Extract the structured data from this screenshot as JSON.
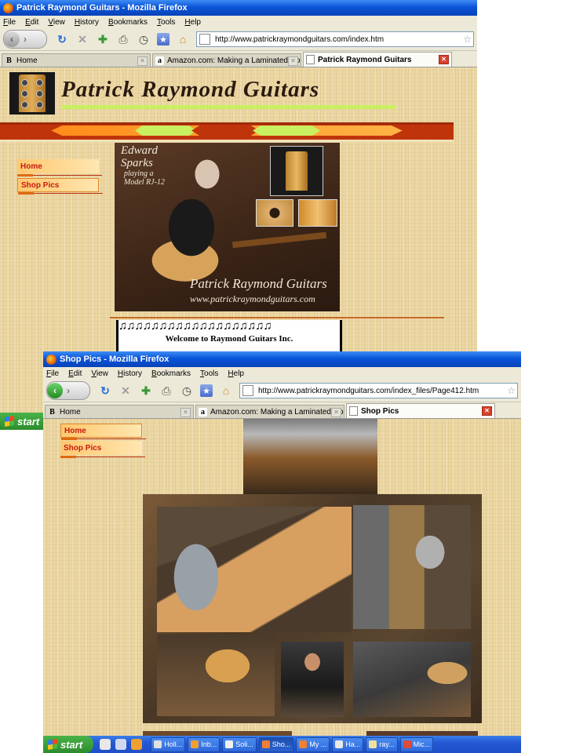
{
  "colors": {
    "title_bar": "#0a55d8",
    "page_background": "#ecd7a2",
    "nav_text": "#c81a0c",
    "accent_green": "#c8f060",
    "accent_orange": "#ff8c1a",
    "accent_red": "#c0340c"
  },
  "icons": [
    "firefox-icon",
    "back-icon",
    "forward-icon",
    "reload-icon",
    "stop-icon",
    "add-bookmark-icon",
    "print-icon",
    "history-icon",
    "bookmarks-icon",
    "home-icon",
    "page-icon",
    "star-icon",
    "tab-close-icon",
    "windows-flag-icon"
  ],
  "window_back": {
    "title": "Patrick Raymond Guitars - Mozilla Firefox",
    "menu": [
      "File",
      "Edit",
      "View",
      "History",
      "Bookmarks",
      "Tools",
      "Help"
    ],
    "url": "http://www.patrickraymondguitars.com/index.htm",
    "tabs": [
      {
        "label": "Home",
        "selected": false
      },
      {
        "label": "Amazon.com: Making a Laminated Hollo...",
        "selected": false
      },
      {
        "label": "Patrick Raymond Guitars",
        "selected": true
      }
    ],
    "page": {
      "site_title": "Patrick Raymond Guitars",
      "nav": [
        "Home",
        "Shop Pics"
      ],
      "photo_caption": [
        "Edward",
        "Sparks",
        "playing a",
        "Model RJ-12"
      ],
      "photo_brand": "Patrick Raymond Guitars",
      "photo_url": "www.patrickraymondguitars.com",
      "notes": "♫♫♫♫♫♫♫♫♫♫♫♫♫♫♫♫♫♫♫",
      "welcome": "Welcome to Raymond Guitars Inc."
    }
  },
  "taskbar_back": {
    "start": "start"
  },
  "window_front": {
    "title": "Shop Pics - Mozilla Firefox",
    "menu": [
      "File",
      "Edit",
      "View",
      "History",
      "Bookmarks",
      "Tools",
      "Help"
    ],
    "url": "http://www.patrickraymondguitars.com/index_files/Page412.htm",
    "tabs": [
      {
        "label": "Home",
        "selected": false
      },
      {
        "label": "Amazon.com: Making a Laminated Hollo...",
        "selected": false
      },
      {
        "label": "Shop Pics",
        "selected": true
      }
    ],
    "page": {
      "nav": [
        "Home",
        "Shop Pics"
      ]
    }
  },
  "taskbar_front": {
    "start": "start",
    "tasks": [
      {
        "label": "Holl..."
      },
      {
        "label": "Inb..."
      },
      {
        "label": "Soli..."
      },
      {
        "label": "Sho...",
        "selected": true
      },
      {
        "label": "My ..."
      },
      {
        "label": "Ha..."
      },
      {
        "label": "ray..."
      },
      {
        "label": "Mic..."
      }
    ]
  }
}
